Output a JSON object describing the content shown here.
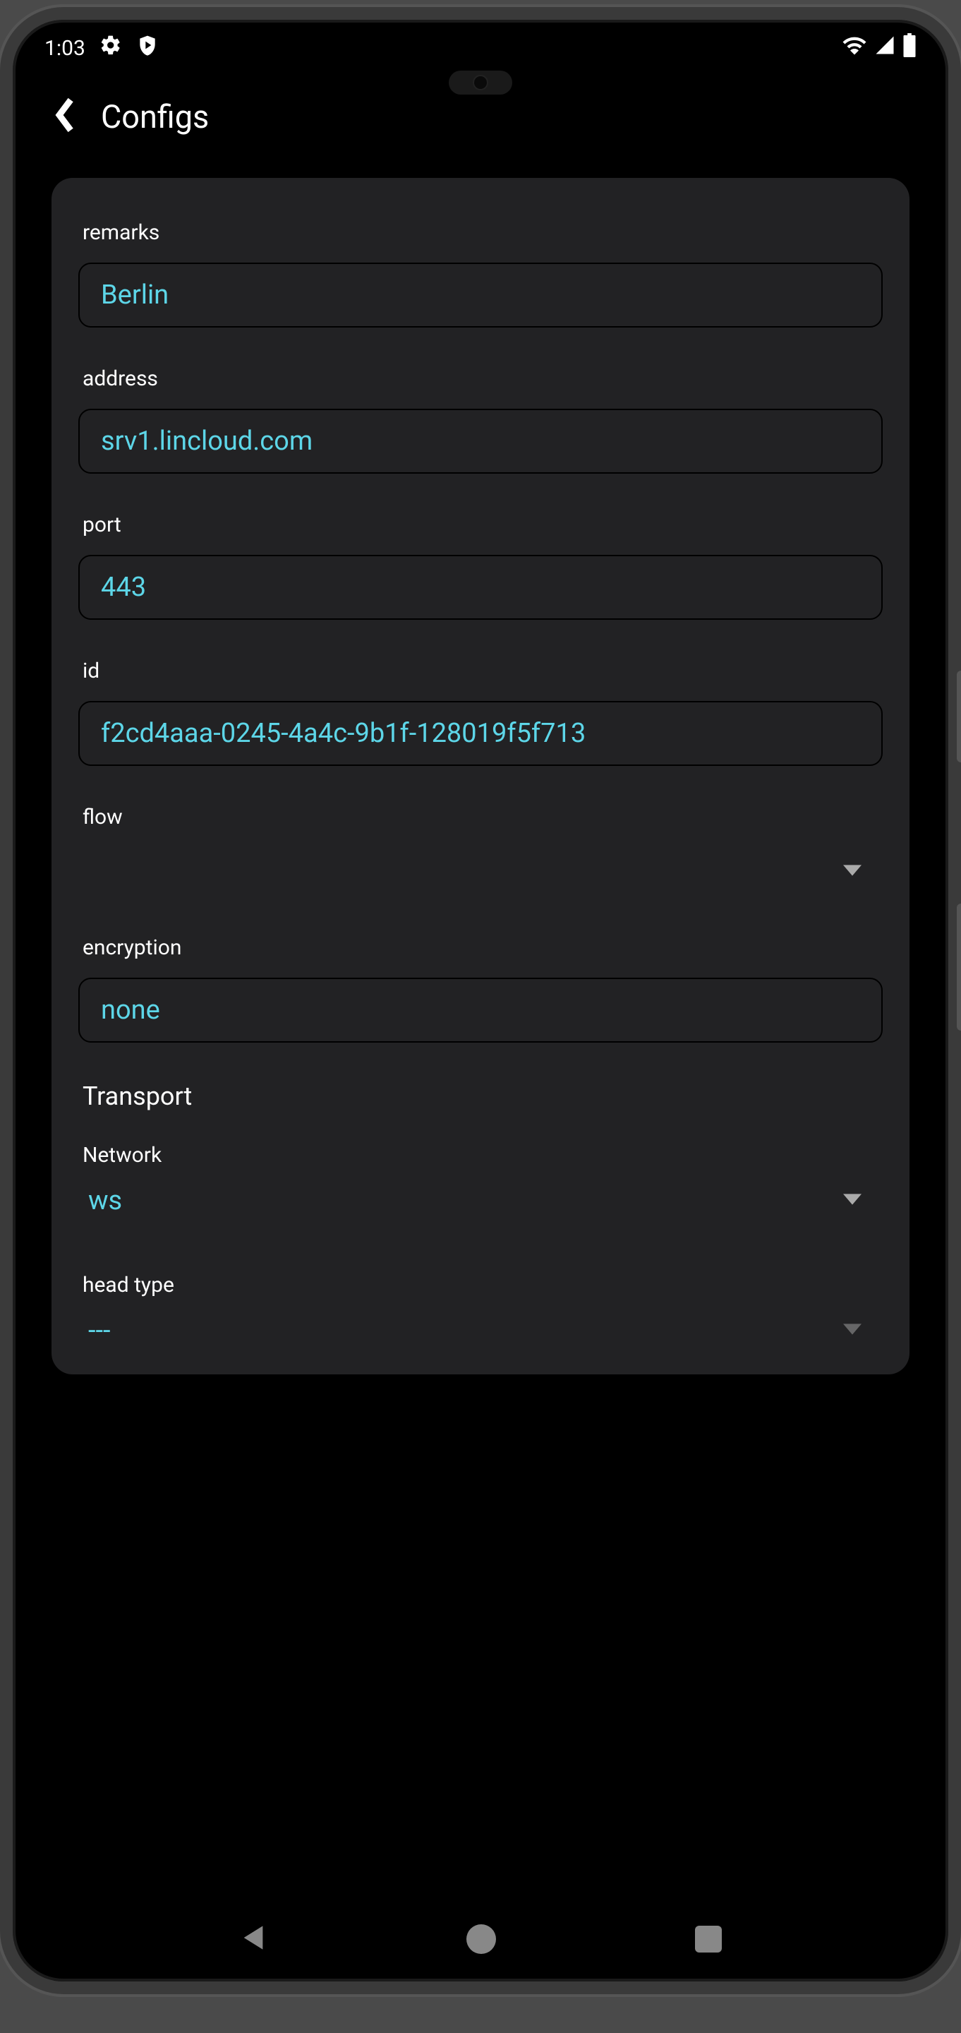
{
  "status": {
    "time": "1:03"
  },
  "header": {
    "title": "Configs"
  },
  "fields": {
    "remarks": {
      "label": "remarks",
      "value": "Berlin"
    },
    "address": {
      "label": "address",
      "value": "srv1.lincloud.com"
    },
    "port": {
      "label": "port",
      "value": "443"
    },
    "id": {
      "label": "id",
      "value": "f2cd4aaa-0245-4a4c-9b1f-128019f5f713"
    },
    "flow": {
      "label": "flow",
      "value": ""
    },
    "encryption": {
      "label": "encryption",
      "value": "none"
    }
  },
  "transport": {
    "heading": "Transport",
    "network": {
      "label": "Network",
      "value": "ws"
    },
    "head_type": {
      "label": "head type",
      "value": "---"
    }
  }
}
